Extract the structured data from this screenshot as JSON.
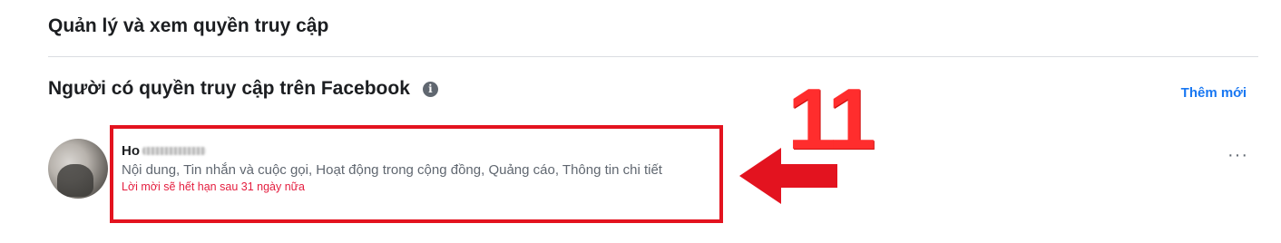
{
  "section": {
    "title": "Quản lý và xem quyền truy cập"
  },
  "access": {
    "title": "Người có quyền truy cập trên Facebook",
    "info_icon": "info-icon",
    "add_label": "Thêm mới"
  },
  "person": {
    "name_visible": "Ho",
    "permissions": "Nội dung, Tin nhắn và cuộc gọi, Hoạt động trong cộng đồng, Quảng cáo, Thông tin chi tiết",
    "invite_status": "Lời mời sẽ hết hạn sau 31 ngày nữa",
    "more_label": "···"
  },
  "annotation": {
    "number": "11"
  },
  "colors": {
    "accent": "#1877f2",
    "warning": "#e41e3f",
    "annotation_red": "#e3131f"
  }
}
